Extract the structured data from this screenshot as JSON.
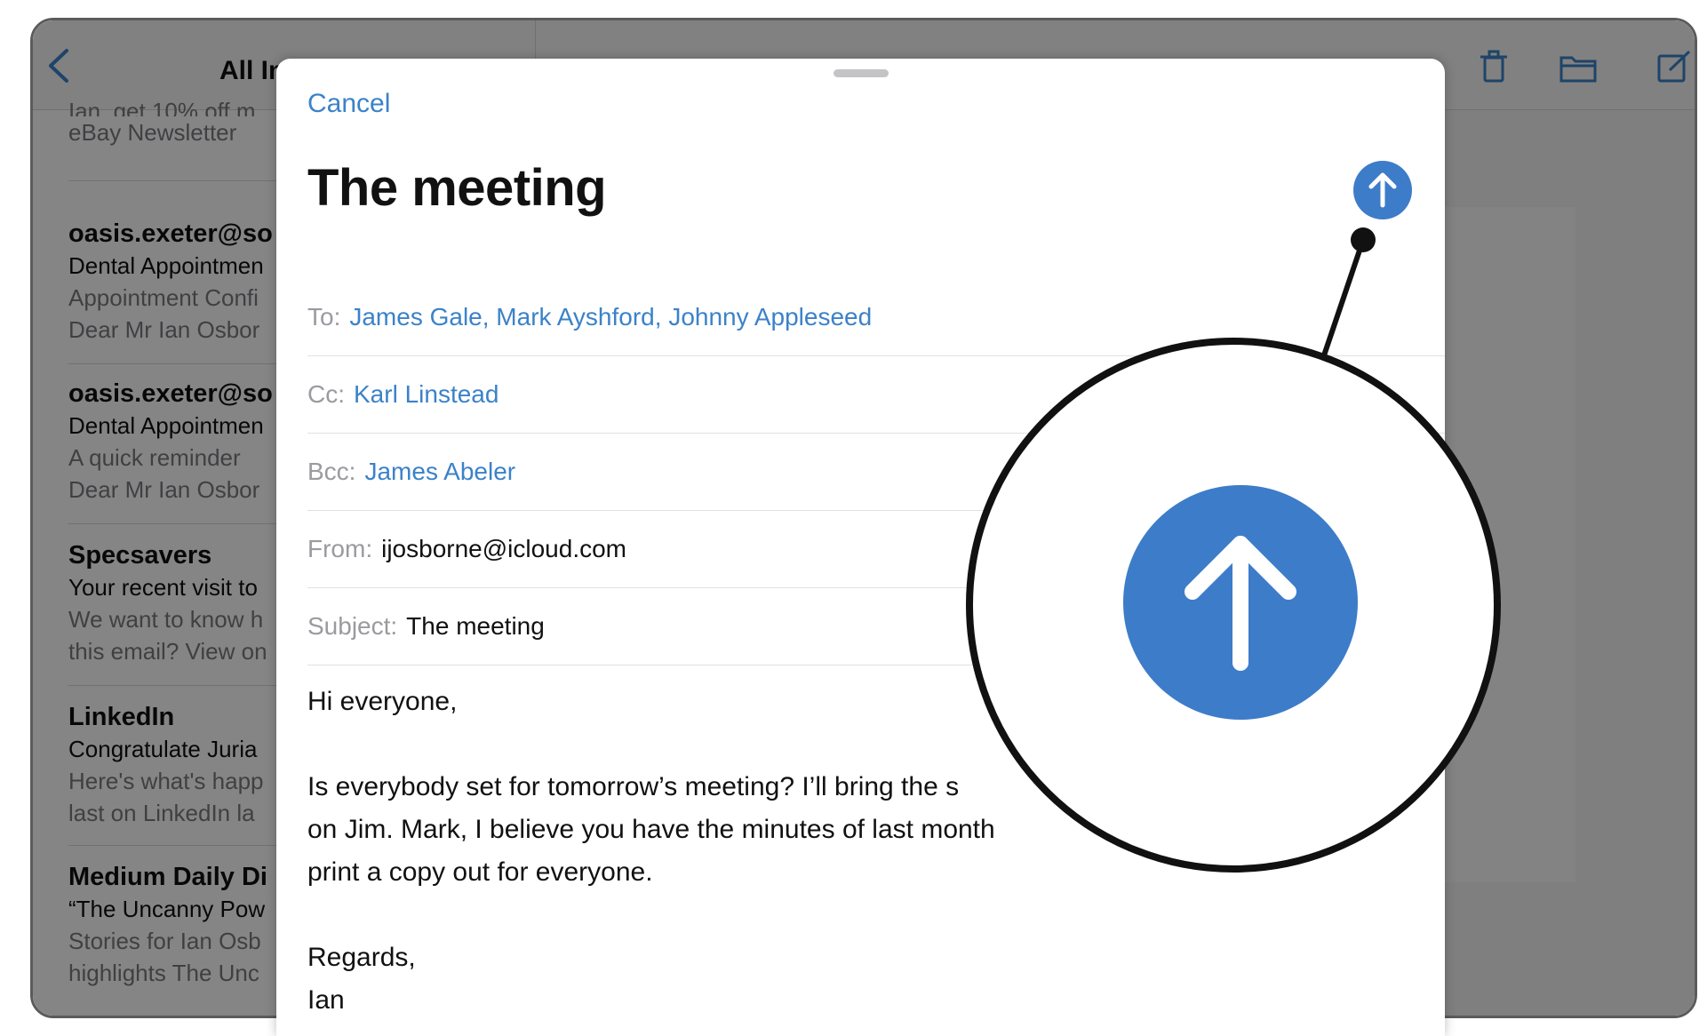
{
  "mail_list": {
    "nav_title": "All In",
    "items": [
      {
        "sender": "",
        "subject": "",
        "preview1": "Ian, get 10% off m",
        "preview2": "eBay Newsletter"
      },
      {
        "sender": "oasis.exeter@so",
        "subject": "Dental Appointmen",
        "preview1": "Appointment Confi",
        "preview2": "Dear Mr Ian Osbor"
      },
      {
        "sender": "oasis.exeter@so",
        "subject": "Dental Appointmen",
        "preview1": "A quick reminder",
        "preview2": "Dear Mr Ian Osbor"
      },
      {
        "sender": "Specsavers",
        "subject": "Your recent visit to",
        "preview1": "We want to know h",
        "preview2": "this email? View on"
      },
      {
        "sender": "LinkedIn",
        "subject": "Congratulate Juria",
        "preview1": "Here's what's happ",
        "preview2": "last on LinkedIn la"
      },
      {
        "sender": "Medium Daily Di",
        "subject": "“The Uncanny Pow",
        "preview1": "Stories for Ian Osb",
        "preview2": "highlights The Unc"
      }
    ]
  },
  "compose": {
    "cancel_label": "Cancel",
    "title": "The meeting",
    "to_label": "To:",
    "to_value": "James Gale, Mark Ayshford, Johnny Appleseed",
    "cc_label": "Cc:",
    "cc_value": "Karl Linstead",
    "bcc_label": "Bcc:",
    "bcc_value": "James Abeler",
    "from_label": "From:",
    "from_value": "ijosborne@icloud.com",
    "subject_label": "Subject:",
    "subject_value": "The meeting",
    "body": {
      "greeting": "Hi everyone,",
      "line1": "Is everybody set for tomorrow’s meeting? I’ll bring the s",
      "line2": "on Jim. Mark, I believe you have the minutes of last month",
      "line3": "print a copy out for everyone.",
      "signoff": "Regards,",
      "name": "Ian"
    }
  },
  "colors": {
    "accent": "#3d7cc9",
    "link": "#3b82c9"
  },
  "icons": {
    "send": "arrow-up-circle",
    "back": "chevron-left",
    "trash": "trash",
    "folder": "folder",
    "compose": "compose"
  }
}
